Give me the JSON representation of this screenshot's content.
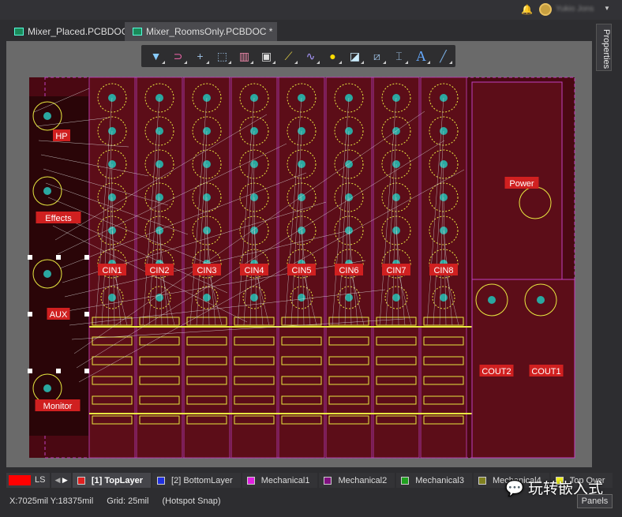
{
  "header": {
    "user_name": "Yukio Jons",
    "bell_icon": "bell-icon"
  },
  "tabs": [
    {
      "label": "Mixer_Placed.PCBDOC *"
    },
    {
      "label": "Mixer_RoomsOnly.PCBDOC *",
      "active": true
    }
  ],
  "properties_panel": "Properties",
  "toolbar": [
    "filter-icon",
    "interactive-routing-icon",
    "cross-icon",
    "select-rect-icon",
    "align-icon",
    "component-icon",
    "route-icon",
    "length-tune-icon",
    "via-icon",
    "polygon-icon",
    "diff-pair-icon",
    "dimension-icon",
    "text-icon",
    "line-icon"
  ],
  "toolbar_text_glyph": "A",
  "board": {
    "rooms": [
      "HP",
      "Effects",
      "AUX",
      "Monitor",
      "CIN1",
      "CIN2",
      "CIN3",
      "CIN4",
      "CIN5",
      "CIN6",
      "CIN7",
      "CIN8",
      "Power",
      "COUT2",
      "COUT1"
    ],
    "colors": {
      "board": "#4a0812",
      "room": "#5c0d18",
      "pad": "#2aa8a0",
      "silk": "#e8e840",
      "outline": "#c040c0",
      "label": "#d02020"
    }
  },
  "layers": {
    "current_color": "#ff0000",
    "ls_label": "LS",
    "items": [
      {
        "label": "[1] TopLayer",
        "color": "#e02020",
        "active": true
      },
      {
        "label": "[2] BottomLayer",
        "color": "#2030e0"
      },
      {
        "label": "Mechanical1",
        "color": "#e020e0"
      },
      {
        "label": "Mechanical2",
        "color": "#801080"
      },
      {
        "label": "Mechanical3",
        "color": "#20a020"
      },
      {
        "label": "Mechanical4",
        "color": "#808020"
      },
      {
        "label": "Top Over",
        "color": "#f0f020"
      }
    ]
  },
  "status": {
    "coords": "X:7025mil Y:18375mil",
    "grid": "Grid: 25mil",
    "snap": "(Hotspot Snap)"
  },
  "panels_button": "Panels",
  "watermark": "玩转嵌入式"
}
